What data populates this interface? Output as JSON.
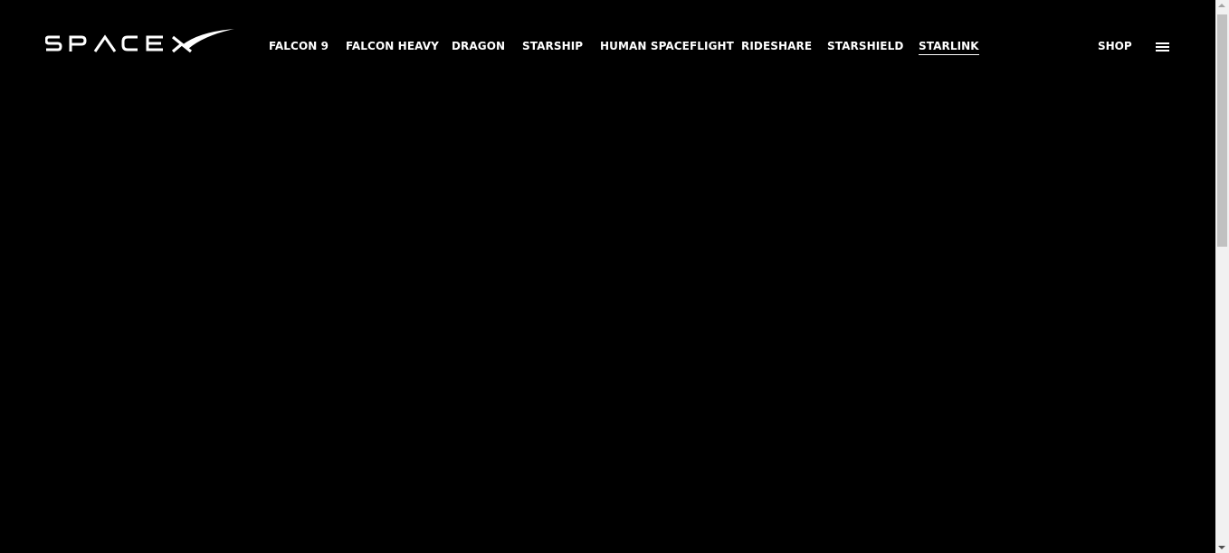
{
  "header": {
    "logo": {
      "text": "SPACEX",
      "icon": "spacex-logo"
    },
    "nav": {
      "items": [
        {
          "label": "FALCON 9"
        },
        {
          "label": "FALCON HEAVY"
        },
        {
          "label": "DRAGON"
        },
        {
          "label": "STARSHIP"
        },
        {
          "label": "HUMAN SPACEFLIGHT"
        },
        {
          "label": "RIDESHARE"
        },
        {
          "label": "STARSHIELD"
        },
        {
          "label": "STARLINK",
          "active": true
        }
      ]
    },
    "shop_label": "SHOP",
    "menu_icon": "hamburger-menu-icon"
  },
  "colors": {
    "background": "#000000",
    "text": "#ffffff",
    "scrollbar_track": "#f1f1f1",
    "scrollbar_thumb": "#c1c1c1"
  },
  "scrollbar": {
    "position_fraction": 0.0
  }
}
